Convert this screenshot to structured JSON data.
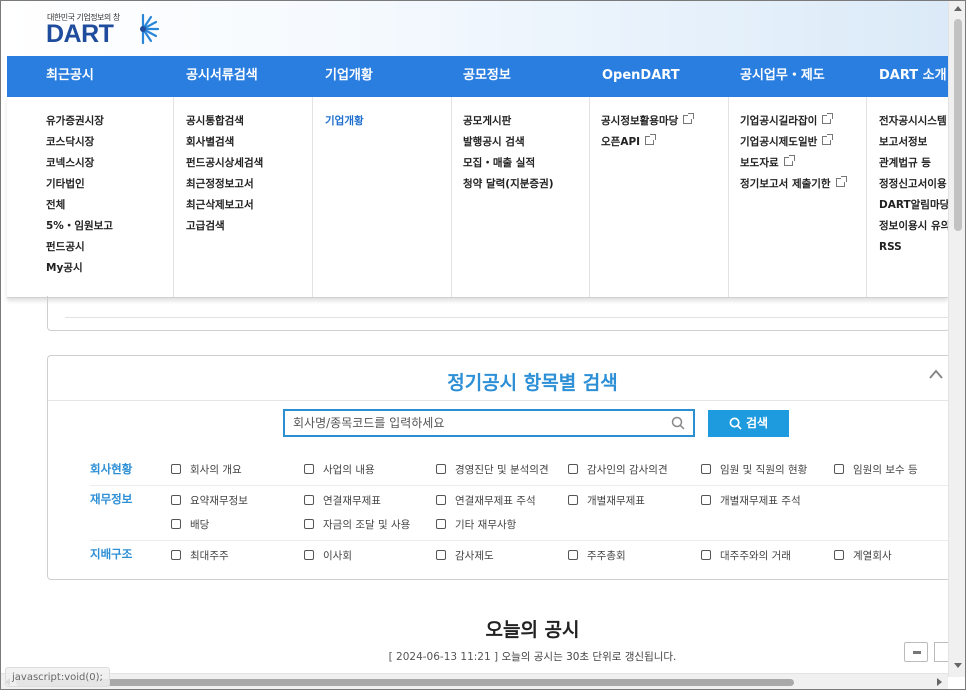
{
  "header": {
    "logo_sub": "대한민국 기업정보의 창",
    "logo_main": "DART"
  },
  "nav": [
    {
      "label": "최근공시"
    },
    {
      "label": "공시서류검색"
    },
    {
      "label": "기업개황"
    },
    {
      "label": "공모정보"
    },
    {
      "label": "OpenDART"
    },
    {
      "label": "공시업무・제도"
    },
    {
      "label": "DART 소개"
    }
  ],
  "mega": [
    {
      "items": [
        "유가증권시장",
        "코스닥시장",
        "코넥스시장",
        "기타법인",
        "전체",
        "5%・임원보고",
        "펀드공시",
        "My공시"
      ]
    },
    {
      "items": [
        "공시통합검색",
        "회사별검색",
        "펀드공시상세검색",
        "최근정정보고서",
        "최근삭제보고서",
        "고급검색"
      ]
    },
    {
      "items": [
        "기업개황"
      ]
    },
    {
      "items": [
        "공모게시판",
        "발행공시 검색",
        "모집・매출 실적",
        "청약 달력(지분증권)"
      ]
    },
    {
      "items": [
        "공시정보활용마당",
        "오픈API"
      ]
    },
    {
      "items": [
        "기업공시길라잡이",
        "기업공시제도일반",
        "보도자료",
        "정기보고서 제출기한"
      ]
    },
    {
      "items": [
        "전자공시시스템",
        "보고서정보",
        "관계법규 등",
        "정정신고서이용",
        "DART알림마당",
        "정보이용시 유의",
        "RSS"
      ]
    }
  ],
  "search": {
    "title": "정기공시 항목별 검색",
    "placeholder": "회사명/종목코드를 입력하세요",
    "button": "검색"
  },
  "categories": {
    "company": {
      "label": "회사현황",
      "items": [
        "회사의 개요",
        "사업의 내용",
        "경영진단 및 분석의견",
        "감사인의 감사의견",
        "임원 및 직원의 현황",
        "임원의 보수 등"
      ]
    },
    "finance": {
      "label": "재무정보",
      "items": [
        "요약재무정보",
        "연결재무제표",
        "연결재무제표 주석",
        "개별재무제표",
        "개별재무제표 주석",
        "배당",
        "자금의 조달 및 사용",
        "기타 재무사항"
      ]
    },
    "governance": {
      "label": "지배구조",
      "items": [
        "최대주주",
        "이사회",
        "감사제도",
        "주주총회",
        "대주주와의 거래",
        "계열회사"
      ]
    }
  },
  "today": {
    "title": "오늘의 공시",
    "timestamp": "[ 2024-06-13 11:21 ]",
    "notice": "오늘의 공시는 30초 단위로 갱신됩니다."
  },
  "status_bar": {
    "text": "javascript:void(0);"
  },
  "colors": {
    "nav_blue": "#2a7ee0",
    "accent_blue": "#2d8fd6",
    "button_blue": "#1d9bde",
    "logo_blue": "#1f4c9c"
  }
}
